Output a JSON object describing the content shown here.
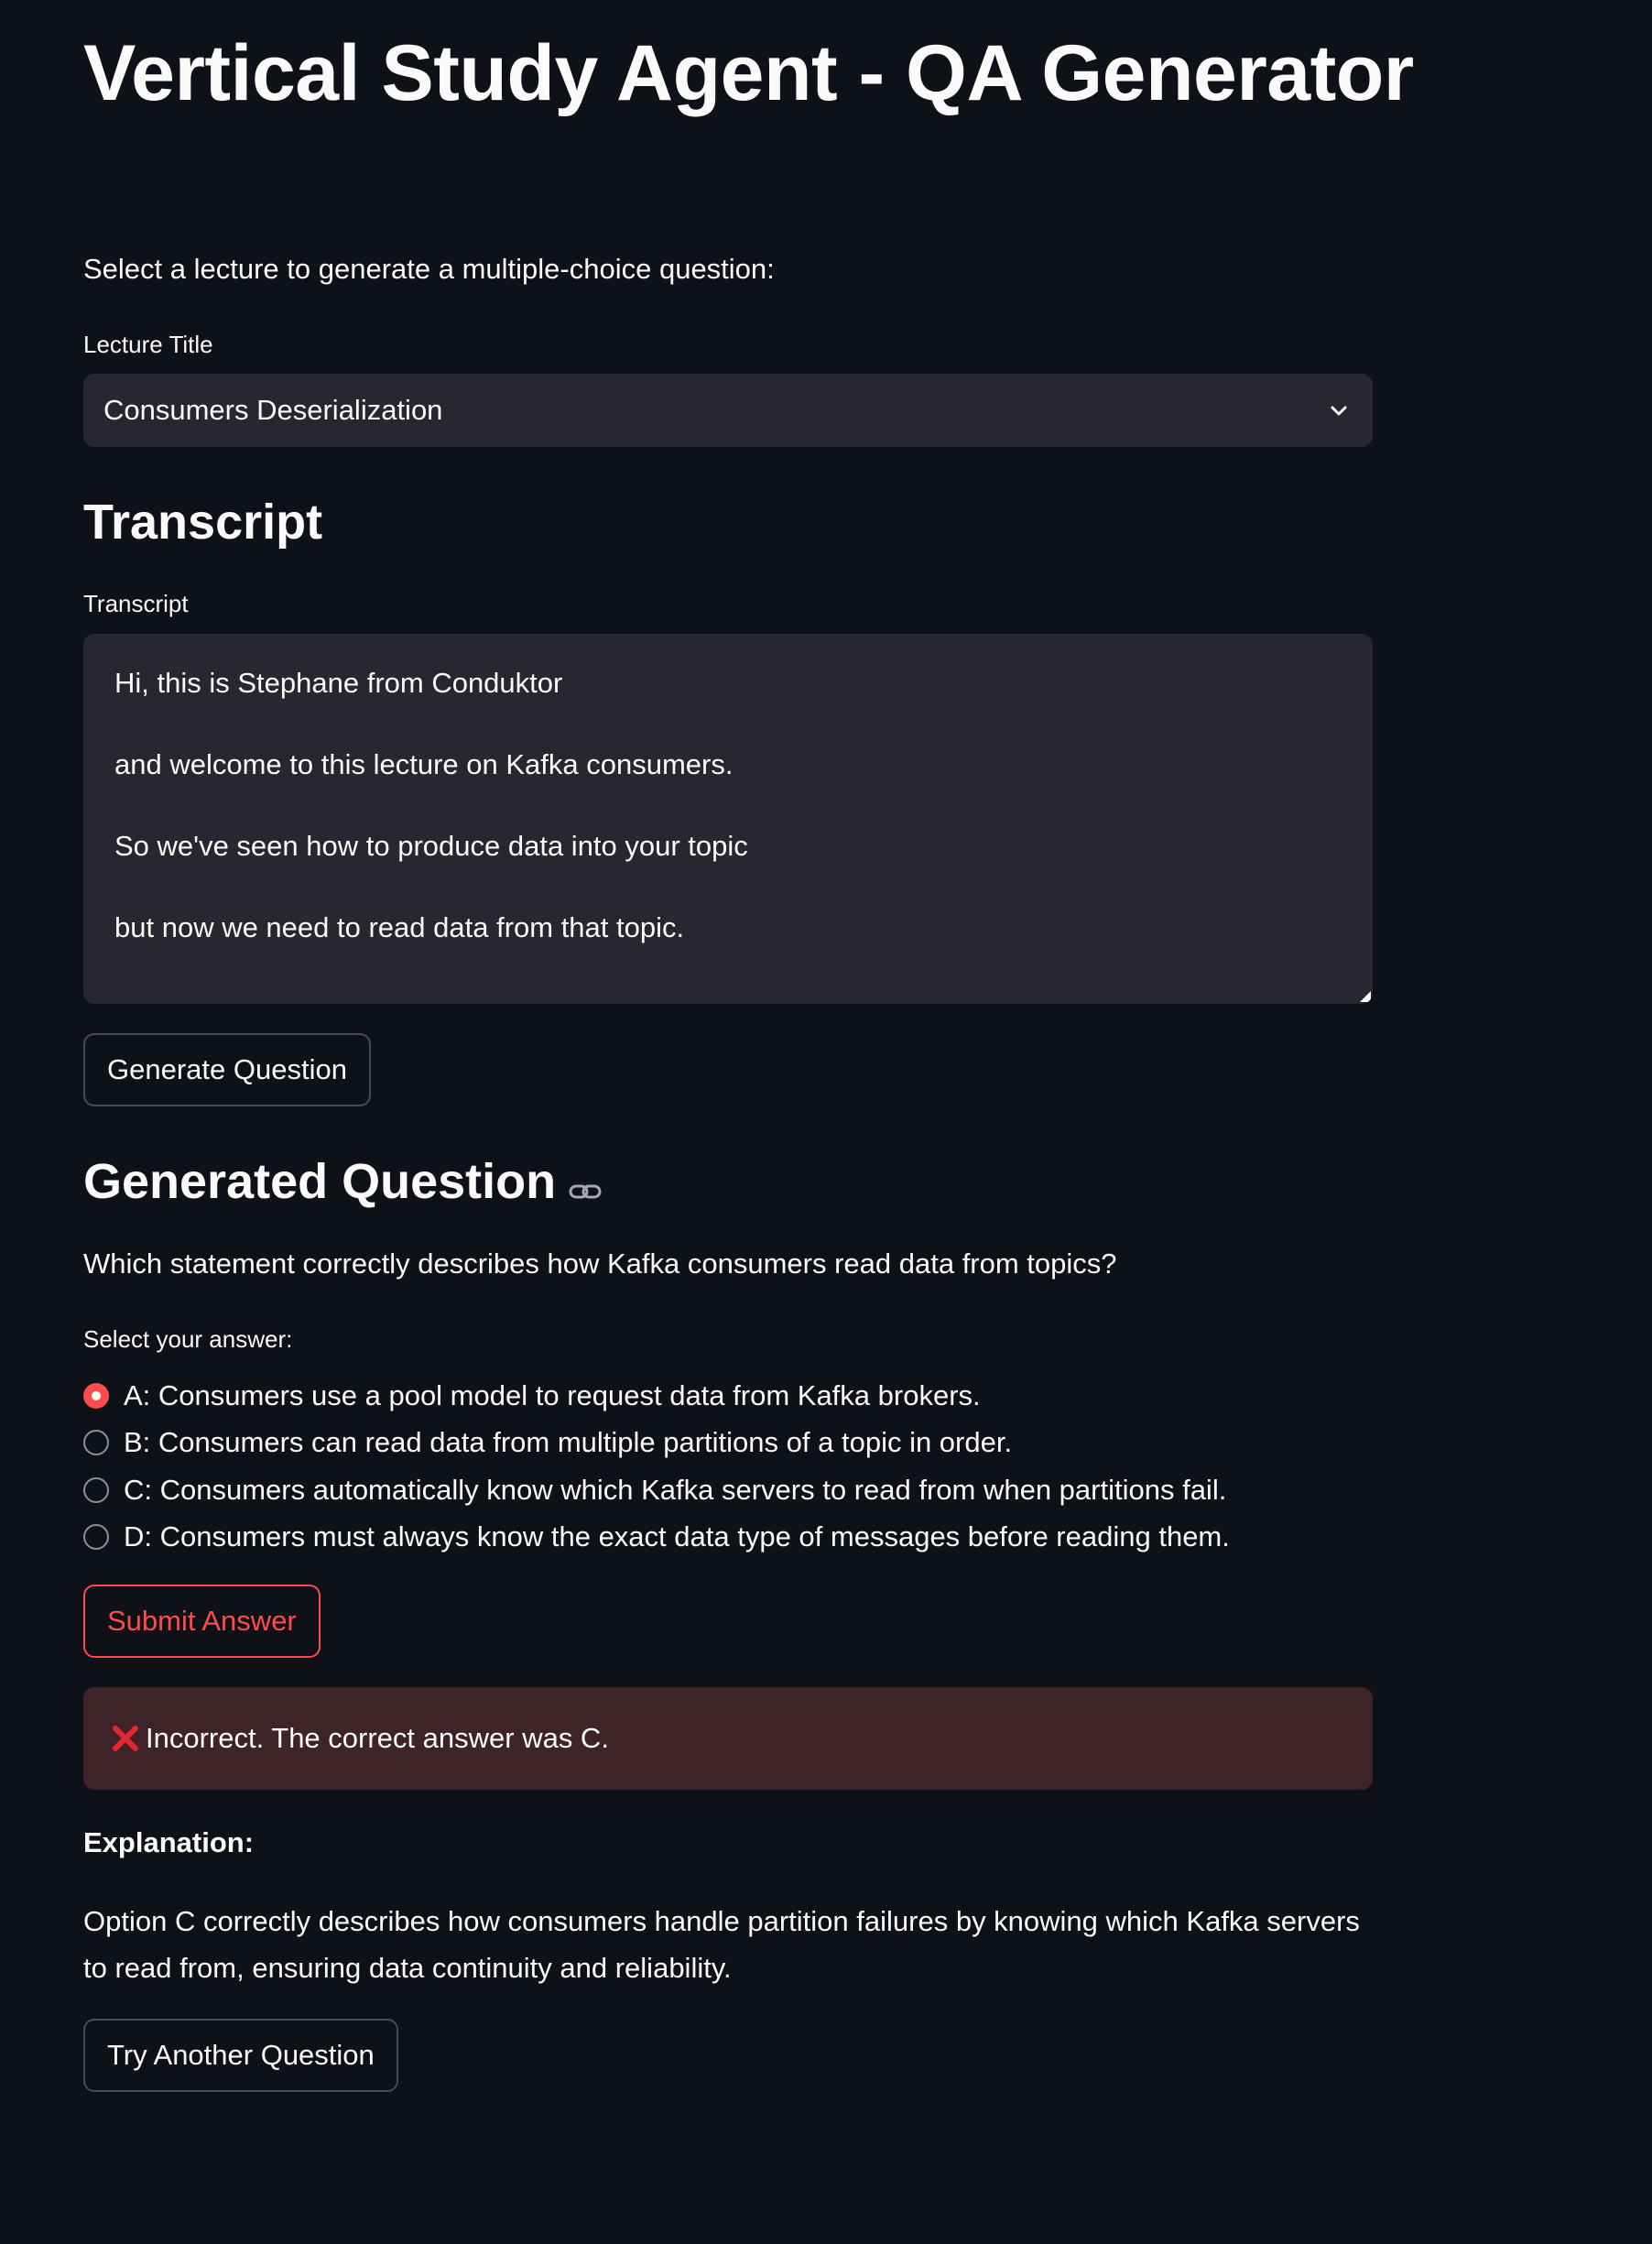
{
  "app": {
    "title": "Vertical Study Agent - QA Generator",
    "intro": "Select a lecture to generate a multiple-choice question:"
  },
  "lecture_select": {
    "label": "Lecture Title",
    "value": "Consumers Deserialization"
  },
  "transcript": {
    "heading": "Transcript",
    "label": "Transcript",
    "lines": [
      "Hi, this is Stephane from Conduktor",
      "and welcome to this lecture on Kafka consumers.",
      "So we've seen how to produce data into your topic",
      "but now we need to read data from that topic."
    ]
  },
  "generate_button": "Generate Question",
  "generated": {
    "heading": "Generated Question",
    "question": "Which statement correctly describes how Kafka consumers read data from topics?",
    "answer_label": "Select your answer:",
    "options": [
      "A: Consumers use a pool model to request data from Kafka brokers.",
      "B: Consumers can read data from multiple partitions of a topic in order.",
      "C: Consumers automatically know which Kafka servers to read from when partitions fail.",
      "D: Consumers must always know the exact data type of messages before reading them."
    ],
    "selected_index": 0
  },
  "submit_button": "Submit Answer",
  "result": {
    "message": "Incorrect. The correct answer was C.",
    "icon": "red-x-icon"
  },
  "explanation": {
    "heading": "Explanation:",
    "text": "Option C correctly describes how consumers handle partition failures by knowing which Kafka servers to read from, ensuring data continuity and reliability."
  },
  "try_again_button": "Try Another Question",
  "colors": {
    "background": "#0e1117",
    "widget": "#262730",
    "accent": "#ff4b4b",
    "error_bg": "#3e2428"
  }
}
